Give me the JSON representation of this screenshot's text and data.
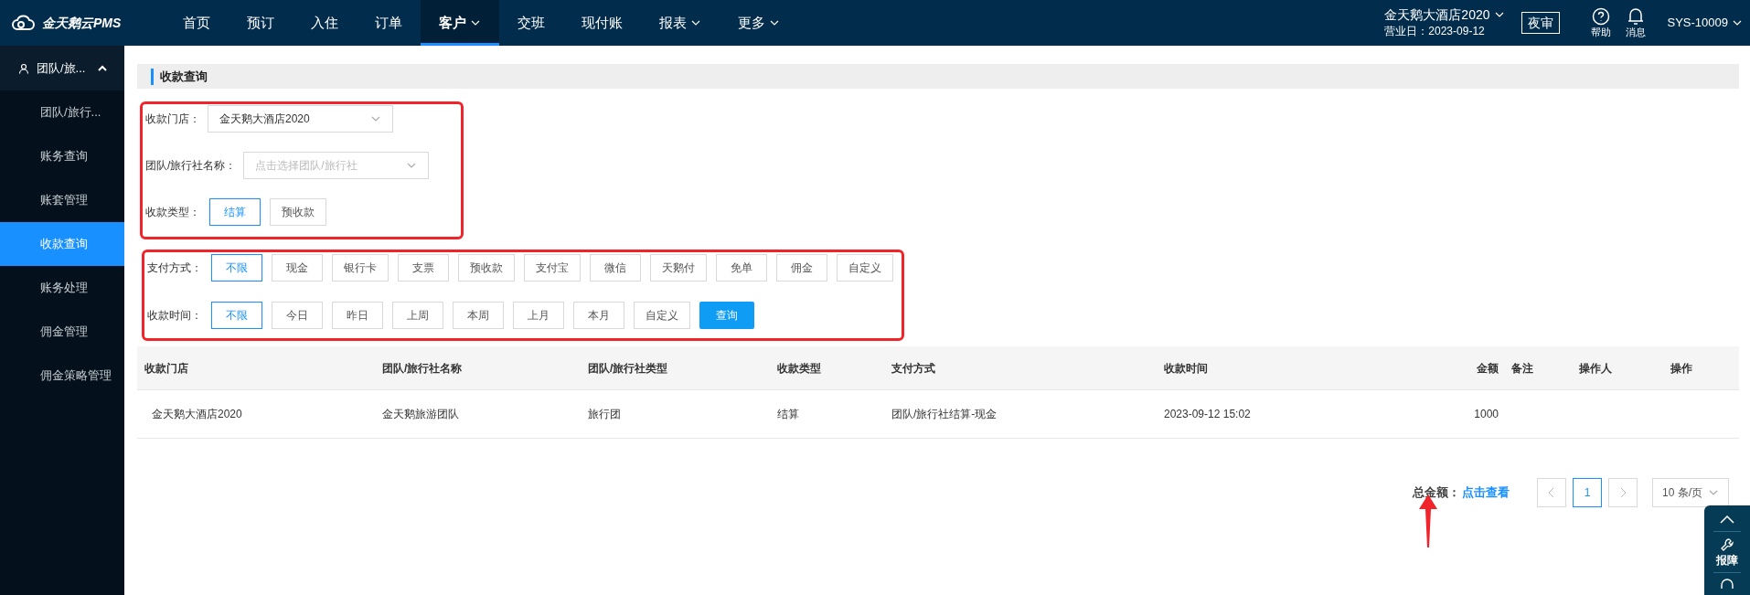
{
  "header": {
    "logo": "金天鹅云PMS",
    "nav": [
      {
        "label": "首页",
        "selected": false,
        "dropdown": false
      },
      {
        "label": "预订",
        "selected": false,
        "dropdown": false
      },
      {
        "label": "入住",
        "selected": false,
        "dropdown": false
      },
      {
        "label": "订单",
        "selected": false,
        "dropdown": false
      },
      {
        "label": "客户",
        "selected": true,
        "dropdown": true
      },
      {
        "label": "交班",
        "selected": false,
        "dropdown": false
      },
      {
        "label": "现付账",
        "selected": false,
        "dropdown": false
      },
      {
        "label": "报表",
        "selected": false,
        "dropdown": true
      },
      {
        "label": "更多",
        "selected": false,
        "dropdown": true
      }
    ],
    "hotel": "金天鹅大酒店2020",
    "business_date": "营业日：2023-09-12",
    "night_audit": "夜审",
    "help": "帮助",
    "messages": "消息",
    "user": "SYS-10009"
  },
  "sidebar": {
    "group": "团队/旅...",
    "expanded": true,
    "items": [
      {
        "label": "团队/旅行...",
        "selected": false
      },
      {
        "label": "账务查询",
        "selected": false
      },
      {
        "label": "账套管理",
        "selected": false
      },
      {
        "label": "收款查询",
        "selected": true
      },
      {
        "label": "账务处理",
        "selected": false
      },
      {
        "label": "佣金管理",
        "selected": false
      },
      {
        "label": "佣金策略管理",
        "selected": false
      }
    ]
  },
  "page_title": "收款查询",
  "filters": {
    "store_label": "收款门店：",
    "store_value": "金天鹅大酒店2020",
    "agency_label": "团队/旅行社名称：",
    "agency_placeholder": "点击选择团队/旅行社",
    "type_label": "收款类型：",
    "types": [
      {
        "label": "结算",
        "selected": true
      },
      {
        "label": "预收款",
        "selected": false
      }
    ],
    "pay_label": "支付方式：",
    "pay_methods": [
      {
        "label": "不限",
        "selected": true
      },
      {
        "label": "现金",
        "selected": false
      },
      {
        "label": "银行卡",
        "selected": false
      },
      {
        "label": "支票",
        "selected": false
      },
      {
        "label": "预收款",
        "selected": false
      },
      {
        "label": "支付宝",
        "selected": false
      },
      {
        "label": "微信",
        "selected": false
      },
      {
        "label": "天鹅付",
        "selected": false
      },
      {
        "label": "免单",
        "selected": false
      },
      {
        "label": "佣金",
        "selected": false
      },
      {
        "label": "自定义",
        "selected": false
      }
    ],
    "time_label": "收款时间：",
    "times": [
      {
        "label": "不限",
        "selected": true
      },
      {
        "label": "今日",
        "selected": false
      },
      {
        "label": "昨日",
        "selected": false
      },
      {
        "label": "上周",
        "selected": false
      },
      {
        "label": "本周",
        "selected": false
      },
      {
        "label": "上月",
        "selected": false
      },
      {
        "label": "本月",
        "selected": false
      },
      {
        "label": "自定义",
        "selected": false
      }
    ],
    "search_button": "查询"
  },
  "table": {
    "columns": [
      "收款门店",
      "团队/旅行社名称",
      "团队/旅行社类型",
      "收款类型",
      "支付方式",
      "收款时间",
      "金额",
      "备注",
      "操作人",
      "操作"
    ],
    "rows": [
      [
        "金天鹅大酒店2020",
        "金天鹅旅游团队",
        "旅行团",
        "结算",
        "团队/旅行社结算-现金",
        "2023-09-12 15:02",
        "1000",
        "",
        "",
        ""
      ]
    ]
  },
  "footer": {
    "total_label": "总金额：",
    "total_link": "点击查看",
    "pages": [
      {
        "label": "1",
        "selected": true
      }
    ],
    "page_size": "10 条/页"
  },
  "float_panel": {
    "report": "报障"
  }
}
